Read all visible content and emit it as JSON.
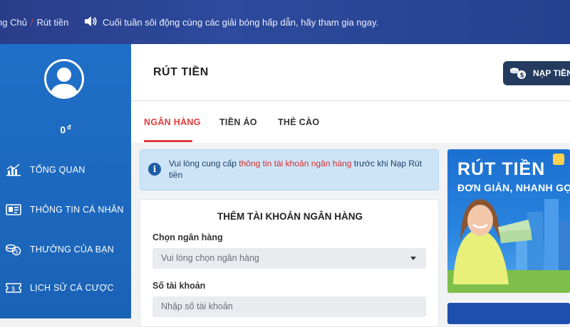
{
  "topbar": {
    "breadcrumb": {
      "home": "ng Chủ",
      "current": "Rút tiền"
    },
    "notice": "Cuối tuần sôi động cùng các giải bóng hấp dẫn, hãy tham gia ngay."
  },
  "sidebar": {
    "balance": "0",
    "currency": "đ",
    "items": [
      {
        "label": "TỔNG QUAN",
        "icon": "chart-icon"
      },
      {
        "label": "THÔNG TIN CÁ NHÂN",
        "icon": "id-card-icon"
      },
      {
        "label": "THƯỞNG CỦA BẠN",
        "icon": "coins-icon"
      },
      {
        "label": "LỊCH SỬ CÁ CƯỢC",
        "icon": "ticket-icon"
      }
    ]
  },
  "main": {
    "title": "RÚT TIỀN",
    "deposit_button": "NẠP TIỀN",
    "tabs": [
      "NGÂN HÀNG",
      "TIỀN ẢO",
      "THẺ CÀO"
    ],
    "info": {
      "prefix": "Vui lòng cung cấp ",
      "highlight": "thông tin tài khoản ngân hàng",
      "suffix": " trước khi Nạp Rút tiền"
    },
    "form": {
      "title": "THÊM TÀI KHOẢN NGÂN HÀNG",
      "bank_label": "Chọn ngân hàng",
      "bank_placeholder": "Vui lòng chọn ngân hàng",
      "account_label": "Số tài khoản",
      "account_placeholder": "Nhập số tài khoản"
    },
    "banner": {
      "title": "RÚT TIỀN",
      "subtitle": "ĐƠN GIẢN, NHANH GỌN"
    }
  },
  "colors": {
    "accent_red": "#e03b3b",
    "sidebar_blue": "#1f6fc8",
    "topbar_navy": "#2a3d8a"
  }
}
